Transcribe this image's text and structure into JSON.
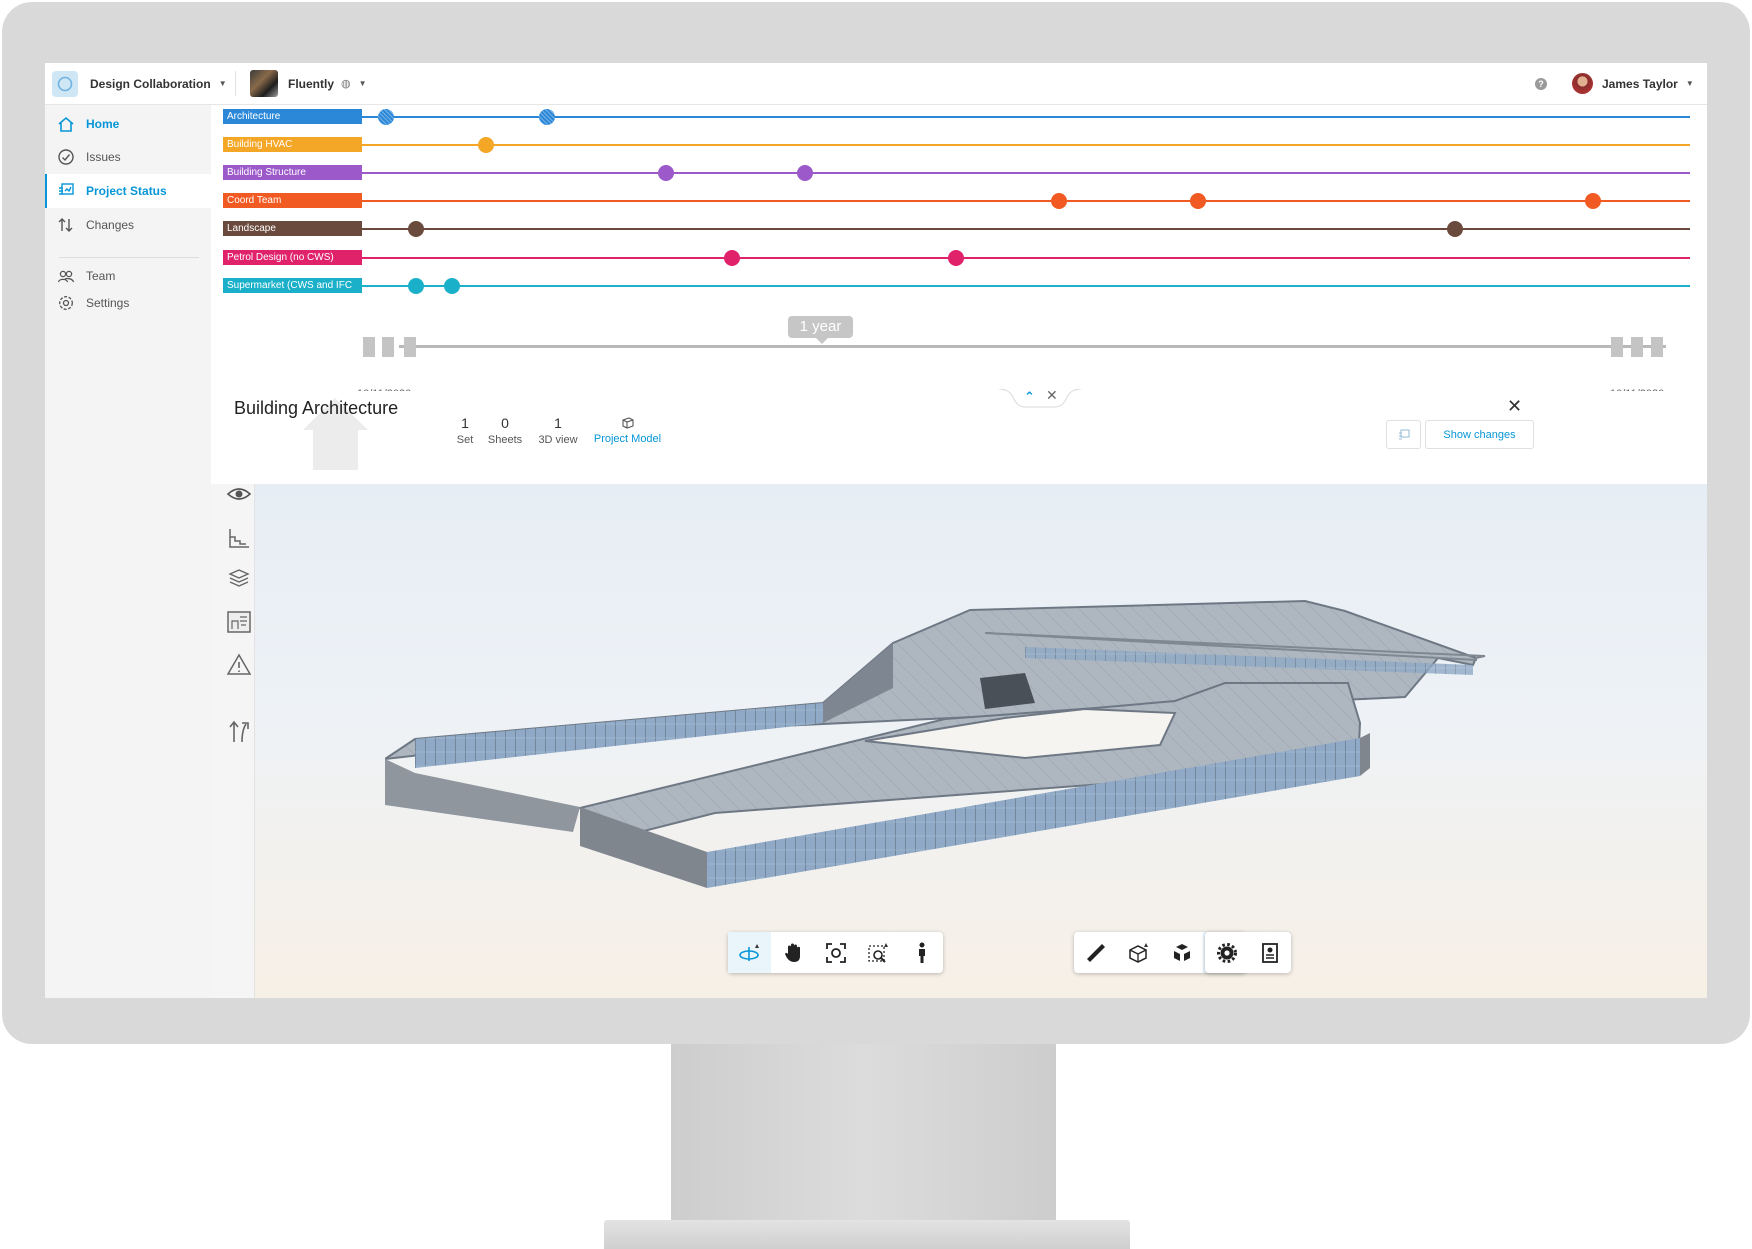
{
  "app": {
    "name": "Design Collaboration"
  },
  "project": {
    "name": "Fluently"
  },
  "user": {
    "name": "James Taylor"
  },
  "sidebar": {
    "items": [
      {
        "label": "Home"
      },
      {
        "label": "Issues"
      },
      {
        "label": "Project Status"
      },
      {
        "label": "Changes"
      },
      {
        "label": "Team"
      },
      {
        "label": "Settings"
      }
    ]
  },
  "timeline": {
    "tracks": [
      {
        "label": "Architecture",
        "color": "#2b88d8",
        "hatched": true
      },
      {
        "label": "Building HVAC",
        "color": "#f4a627",
        "hatched": false
      },
      {
        "label": "Building Structure",
        "color": "#9b59c9",
        "hatched": false
      },
      {
        "label": "Coord Team",
        "color": "#f15a22",
        "hatched": false
      },
      {
        "label": "Landscape",
        "color": "#6b4a3e",
        "hatched": false
      },
      {
        "label": "Petrol Design (no CWS)",
        "color": "#e0226b",
        "hatched": false
      },
      {
        "label": "Supermarket (CWS and IFC",
        "color": "#1bb0c9",
        "hatched": false
      }
    ],
    "range_label": "1 year",
    "start_date": "10/11/2020",
    "end_date": "10/11/2020"
  },
  "model": {
    "title": "Building Architecture",
    "stats": [
      {
        "num": "1",
        "label": "Set"
      },
      {
        "num": "0",
        "label": "Sheets"
      },
      {
        "num": "1",
        "label": "3D view"
      },
      {
        "num": "",
        "label": "Project Model"
      }
    ],
    "show_changes": "Show changes"
  },
  "icons": {
    "nav": [
      "home-icon",
      "issues-check-icon",
      "project-status-icon",
      "changes-arrows-icon",
      "team-icon",
      "settings-gear-icon"
    ],
    "rail": [
      "eye-icon",
      "levels-icon",
      "layers-icon",
      "sheet-icon",
      "warning-icon",
      "compare-arrows-icon"
    ],
    "toolbar": [
      "orbit-icon",
      "pan-icon",
      "fit-view-icon",
      "zoom-window-icon",
      "walk-icon",
      "measure-icon",
      "section-icon",
      "explode-icon",
      "visibility-icon",
      "settings-icon",
      "properties-icon"
    ]
  }
}
